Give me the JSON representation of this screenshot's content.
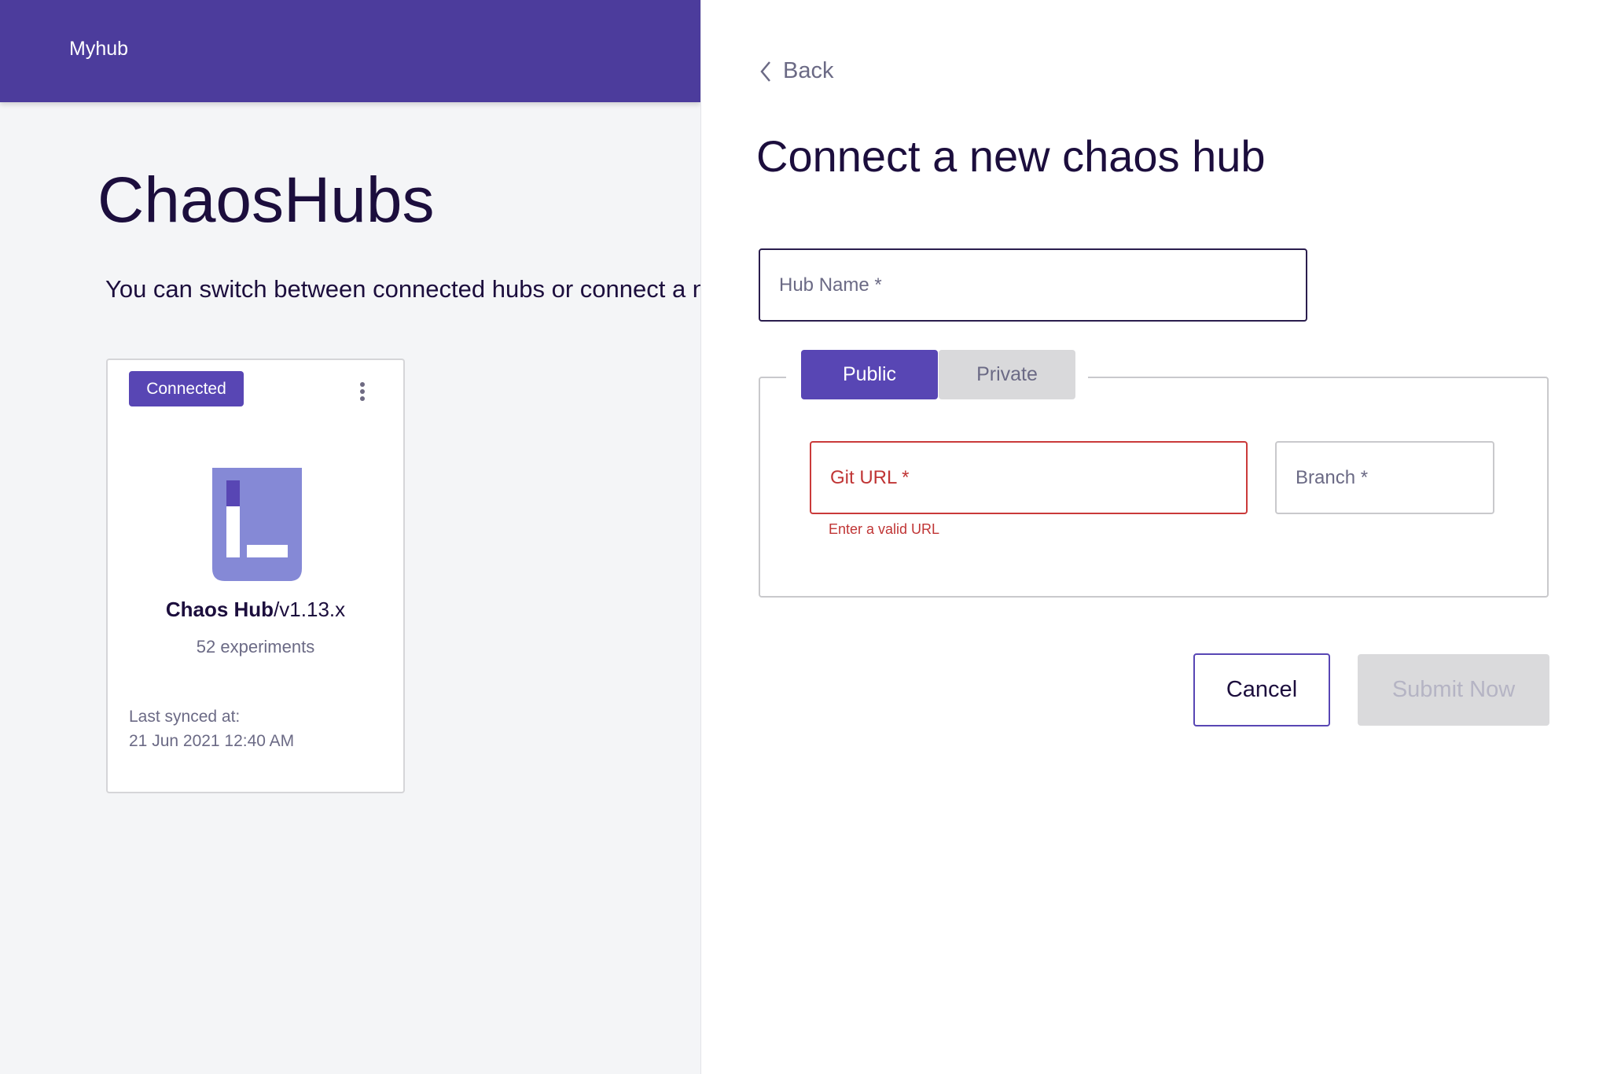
{
  "header": {
    "brand": "Myhub"
  },
  "main": {
    "title": "ChaosHubs",
    "subtitle": "You can switch between connected hubs or connect a new hub"
  },
  "hub_card": {
    "status": "Connected",
    "name": "Chaos Hub",
    "branch": "/v1.13.x",
    "experiments": "52 experiments",
    "sync_label": "Last synced at:",
    "sync_date": "21 Jun 2021 12:40 AM"
  },
  "form": {
    "back_label": "Back",
    "title": "Connect a new chaos hub",
    "hub_name_placeholder": "Hub Name *",
    "tabs": [
      {
        "label": "Public",
        "selected": true
      },
      {
        "label": "Private",
        "selected": false
      }
    ],
    "git_url_placeholder": "Git URL *",
    "git_url_error": "Enter a valid URL",
    "branch_placeholder": "Branch *",
    "cancel_label": "Cancel",
    "submit_label": "Submit Now"
  },
  "colors": {
    "brand": "#4c3c9c",
    "accent": "#5846b4",
    "error": "#c03535",
    "icon": "#8589d6"
  }
}
